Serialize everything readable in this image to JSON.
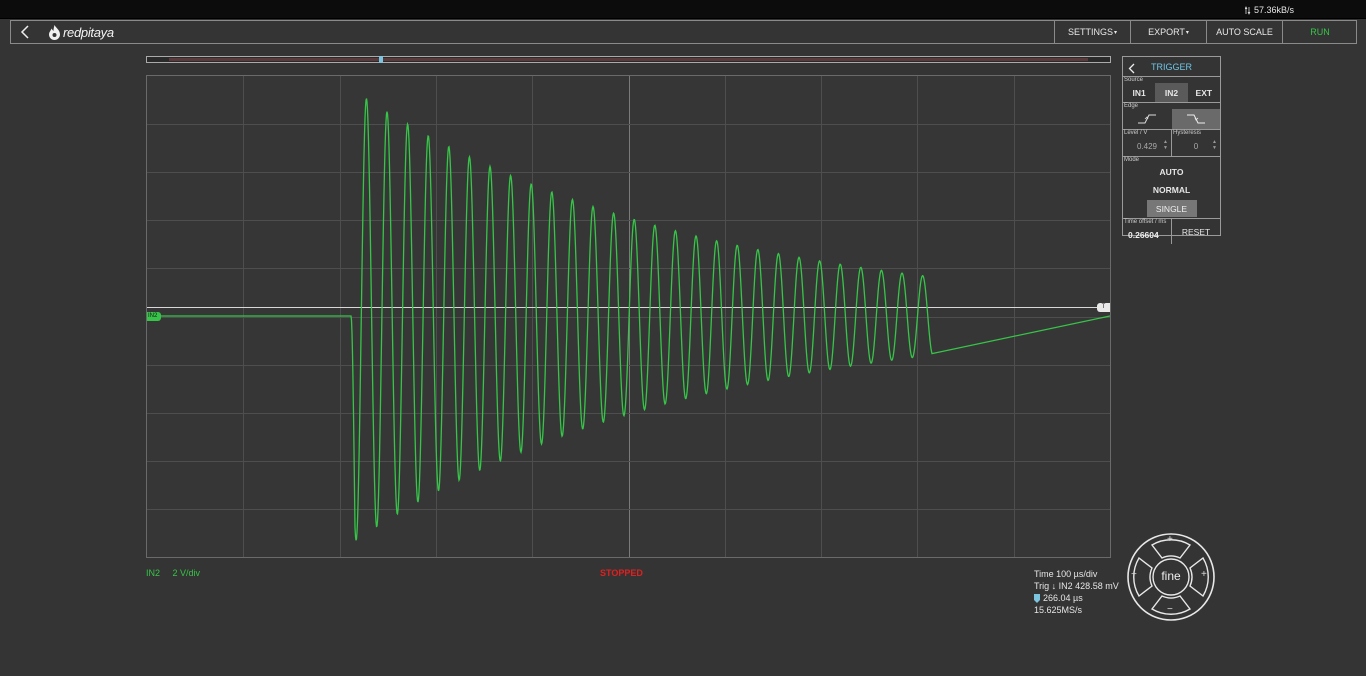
{
  "status_bar": {
    "rate": "57.36kB/s"
  },
  "navbar": {
    "brand": "redpitaya",
    "settings": "SETTINGS",
    "export": "EXPORT",
    "auto_scale": "AUTO SCALE",
    "run": "RUN"
  },
  "colors": {
    "run": "#36c548",
    "trace": "#36c548",
    "trigger_accent": "#6ec6e6",
    "stopped": "#e02020"
  },
  "plot": {
    "channel_tag": "IN2",
    "trigger_tag": "T",
    "trigger_marker": "T",
    "channel_name": "IN2",
    "channel_scale": "2 V/div",
    "state": "STOPPED"
  },
  "info": {
    "time": "Time 100 µs/div",
    "trig": "Trig ↓ IN2 428.58 mV",
    "offset": "266.04 µs",
    "samplerate": "15.625MS/s"
  },
  "trigger_panel": {
    "title": "TRIGGER",
    "source_label": "Source",
    "sources": [
      "IN1",
      "IN2",
      "EXT"
    ],
    "selected_source": "IN2",
    "edge_label": "Edge",
    "selected_edge": "falling",
    "level_label": "Level / V",
    "level_value": "0.429",
    "hysteresis_label": "Hysteresis",
    "hysteresis_value": "0",
    "mode_label": "Mode",
    "modes": [
      "AUTO",
      "NORMAL",
      "SINGLE"
    ],
    "selected_mode": "SINGLE",
    "time_offset_label": "Time offset / ms",
    "time_offset_value": "0.26604",
    "reset": "RESET"
  },
  "joystick": {
    "center": "fine",
    "up": "+",
    "down": "−",
    "left": "−",
    "right": "+"
  }
}
